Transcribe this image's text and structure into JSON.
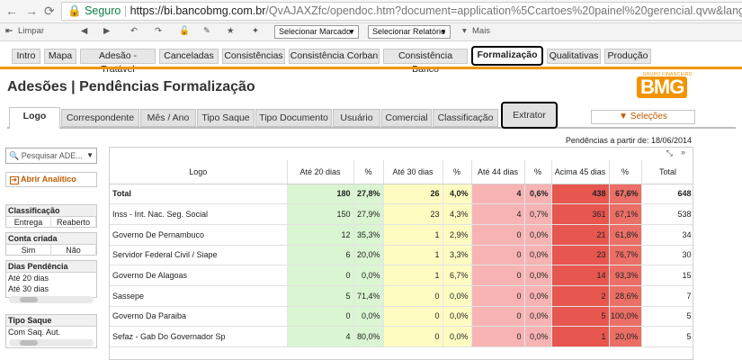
{
  "browser": {
    "back_icon": "arrow-left-icon",
    "forward_icon": "arrow-right-icon",
    "reload_icon": "reload-icon",
    "secure_label": "Seguro",
    "url_domain": "https://bi.bancobmg.com.br",
    "url_path": "/QvAJAXZfc/opendoc.htm?document=application%5Ccartoes%20painel%20gerencial.qvw&lang=pt-BR&host=QV"
  },
  "toolbar": {
    "clear_label": "Limpar",
    "marker_select": "Selecionar Marcador",
    "report_select": "Selecionar Relatório",
    "more_label": "Mais"
  },
  "main_tabs": [
    "Intro",
    "Mapa",
    "Adesão - Tratável",
    "Canceladas",
    "Consistências",
    "Consistência Corban",
    "Consistência Banco",
    "Formalização",
    "Qualitativas",
    "Produção"
  ],
  "page_title": "Adesões | Pendências Formalização",
  "logo": {
    "group": "GRUPO FINANCEIRO",
    "brand": "BMG"
  },
  "sub_tabs": [
    "Logo",
    "Correspondente",
    "Mês / Ano",
    "Tipo Saque",
    "Tipo Documento",
    "Usuário",
    "Comercial",
    "Classificação",
    "Extrator"
  ],
  "selections_label": "▼ Seleções",
  "pending_since": "Pendências a partir de: 18/06/2014",
  "left_panel": {
    "search_placeholder": "Pesquisar ADE...",
    "open_analytic": "Abrir Analítico",
    "classificacao_label": "Classificação",
    "classificacao_opts": [
      "Entrega",
      "Reaberto"
    ],
    "conta_label": "Conta criada",
    "conta_opts": [
      "Sim",
      "Não"
    ],
    "dias_label": "Dias Pendência",
    "dias_opts": [
      "Até 20 dias",
      "Até 30 dias"
    ],
    "tipo_saque_label": "Tipo Saque",
    "tipo_saque_opts": [
      "Com Saq. Aut."
    ]
  },
  "table": {
    "headers": [
      "Logo",
      "Até 20 dias",
      "%",
      "Até 30 dias",
      "%",
      "Até 44 dias",
      "%",
      "Acima 45 dias",
      "%",
      "Total"
    ],
    "rows": [
      [
        "Total",
        "180",
        "27,8%",
        "26",
        "4,0%",
        "4",
        "0,6%",
        "438",
        "67,6%",
        "648"
      ],
      [
        "Inss - Int. Nac. Seg. Social",
        "150",
        "27,9%",
        "23",
        "4,3%",
        "4",
        "0,7%",
        "361",
        "67,1%",
        "538"
      ],
      [
        "Governo De Pernambuco",
        "12",
        "35,3%",
        "1",
        "2,9%",
        "0",
        "0,0%",
        "21",
        "61,8%",
        "34"
      ],
      [
        "Servidor Federal Civil / Siape",
        "6",
        "20,0%",
        "1",
        "3,3%",
        "0",
        "0,0%",
        "23",
        "76,7%",
        "30"
      ],
      [
        "Governo De Alagoas",
        "0",
        "0,0%",
        "1",
        "6,7%",
        "0",
        "0,0%",
        "14",
        "93,3%",
        "15"
      ],
      [
        "Sassepe",
        "5",
        "71,4%",
        "0",
        "0,0%",
        "0",
        "0,0%",
        "2",
        "28,6%",
        "7"
      ],
      [
        "Governo Da Paraiba",
        "0",
        "0,0%",
        "0",
        "0,0%",
        "0",
        "0,0%",
        "5",
        "100,0%",
        "5"
      ],
      [
        "Sefaz - Gab Do Governador Sp",
        "4",
        "80,0%",
        "0",
        "0,0%",
        "0",
        "0,0%",
        "1",
        "20,0%",
        "5"
      ]
    ]
  }
}
